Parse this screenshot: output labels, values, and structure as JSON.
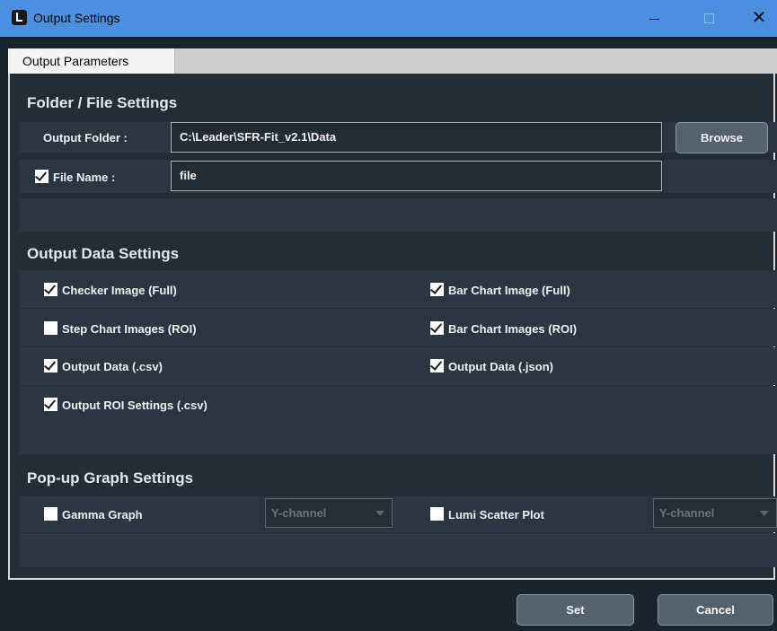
{
  "window": {
    "title": "Output Settings",
    "close_glyph": "✕"
  },
  "tabs": [
    {
      "label": "Output Parameters",
      "active": true
    }
  ],
  "folder_section": {
    "title": "Folder / File Settings",
    "output_folder_label": "Output Folder :",
    "output_folder_value": "C:\\Leader\\SFR-Fit_v2.1\\Data",
    "browse_label": "Browse",
    "file_name_label": "File Name :",
    "file_name_checked": true,
    "file_name_value": "file"
  },
  "output_data_section": {
    "title": "Output Data Settings",
    "options": {
      "checker_image_full": {
        "label": "Checker Image (Full)",
        "checked": true
      },
      "bar_chart_image_full": {
        "label": "Bar Chart Image (Full)",
        "checked": true
      },
      "step_chart_images_roi": {
        "label": "Step Chart Images (ROI)",
        "checked": false
      },
      "bar_chart_images_roi": {
        "label": "Bar Chart Images (ROI)",
        "checked": true
      },
      "output_data_csv": {
        "label": "Output Data (.csv)",
        "checked": true
      },
      "output_data_json": {
        "label": "Output Data (.json)",
        "checked": true
      },
      "output_roi_settings_csv": {
        "label": "Output ROI Settings (.csv)",
        "checked": true
      }
    }
  },
  "popup_section": {
    "title": "Pop-up Graph Settings",
    "gamma_graph": {
      "label": "Gamma Graph",
      "checked": false,
      "channel": "Y-channel"
    },
    "lumi_scatter_plot": {
      "label": "Lumi Scatter Plot",
      "checked": false,
      "channel": "Y-channel"
    }
  },
  "footer": {
    "set_label": "Set",
    "cancel_label": "Cancel"
  },
  "colors": {
    "titlebar": "#4a8fe0",
    "background": "#1b242c",
    "panel": "#232d36",
    "row": "#2b3640",
    "button": "#55616c"
  }
}
